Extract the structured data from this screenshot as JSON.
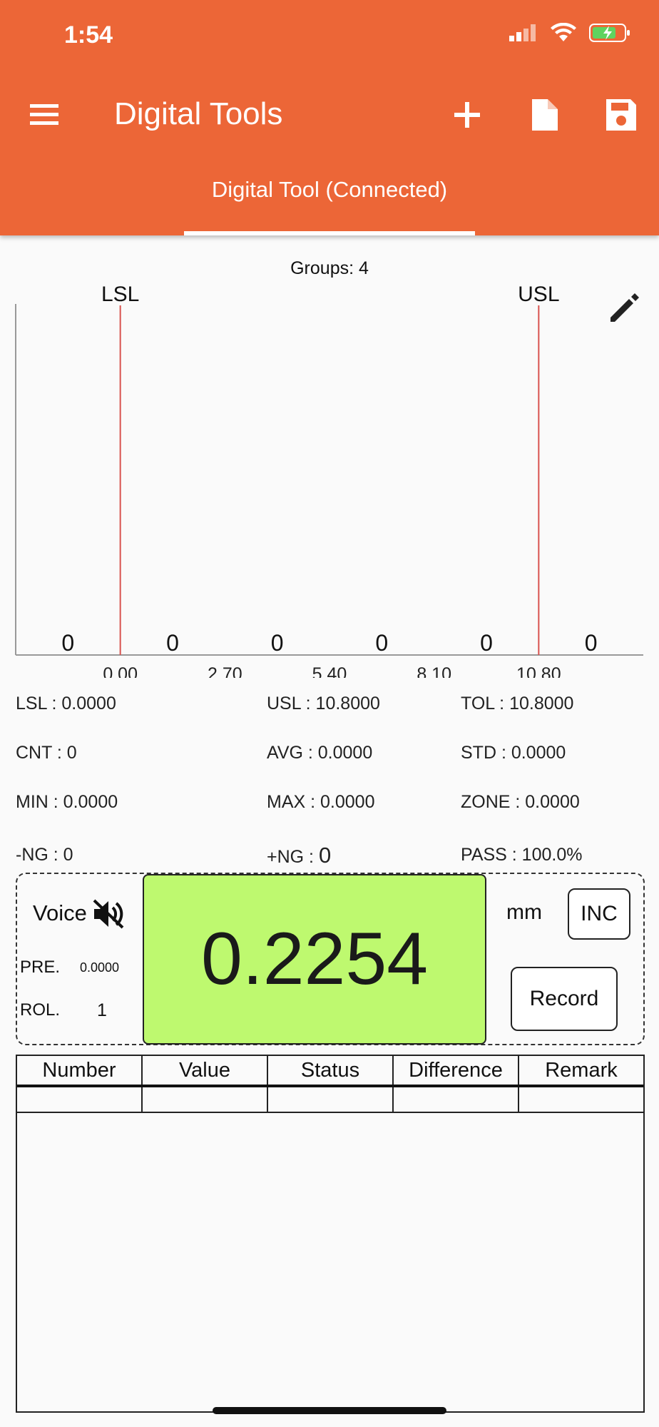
{
  "status_bar": {
    "time": "1:54"
  },
  "app_bar": {
    "title": "Digital Tools",
    "accent_color": "#ec6637"
  },
  "tabs": [
    {
      "label": "Digital Tool (Connected)",
      "active": true
    }
  ],
  "chart_data": {
    "type": "bar",
    "title": "Groups: 4",
    "categories": [
      "",
      "",
      "",
      "",
      "",
      ""
    ],
    "values": [
      0,
      0,
      0,
      0,
      0,
      0
    ],
    "x_tick_labels": [
      "0.00",
      "2.70",
      "5.40",
      "8.10",
      "10.80"
    ],
    "x_ticks": [
      0.0,
      2.7,
      5.4,
      8.1,
      10.8
    ],
    "bin_width": 2.7,
    "limit_lines": [
      {
        "label": "LSL",
        "x": 0.0,
        "color": "#d9534f"
      },
      {
        "label": "USL",
        "x": 10.8,
        "color": "#d9534f"
      }
    ],
    "xlim": [
      -2.7,
      13.5
    ]
  },
  "stats": {
    "lsl": "LSL : 0.0000",
    "usl": "USL : 10.8000",
    "tol": "TOL : 10.8000",
    "cnt": "CNT : 0",
    "avg": "AVG : 0.0000",
    "std": "STD : 0.0000",
    "min": "MIN : 0.0000",
    "max": "MAX : 0.0000",
    "zone": "ZONE : 0.0000",
    "neg_ng": "-NG : 0",
    "pos_ng_label": "+NG : ",
    "pos_ng_value": "0",
    "pass": "PASS : 100.0%"
  },
  "measurement": {
    "voice_label": "Voice",
    "pre_label": "PRE.",
    "pre_value": "0.0000",
    "rol_label": "ROL.",
    "rol_value": "1",
    "reading": "0.2254",
    "unit": "mm",
    "inc_label": "INC",
    "record_label": "Record",
    "display_color": "#bef96f"
  },
  "table": {
    "columns": [
      "Number",
      "Value",
      "Status",
      "Difference",
      "Remark"
    ]
  }
}
